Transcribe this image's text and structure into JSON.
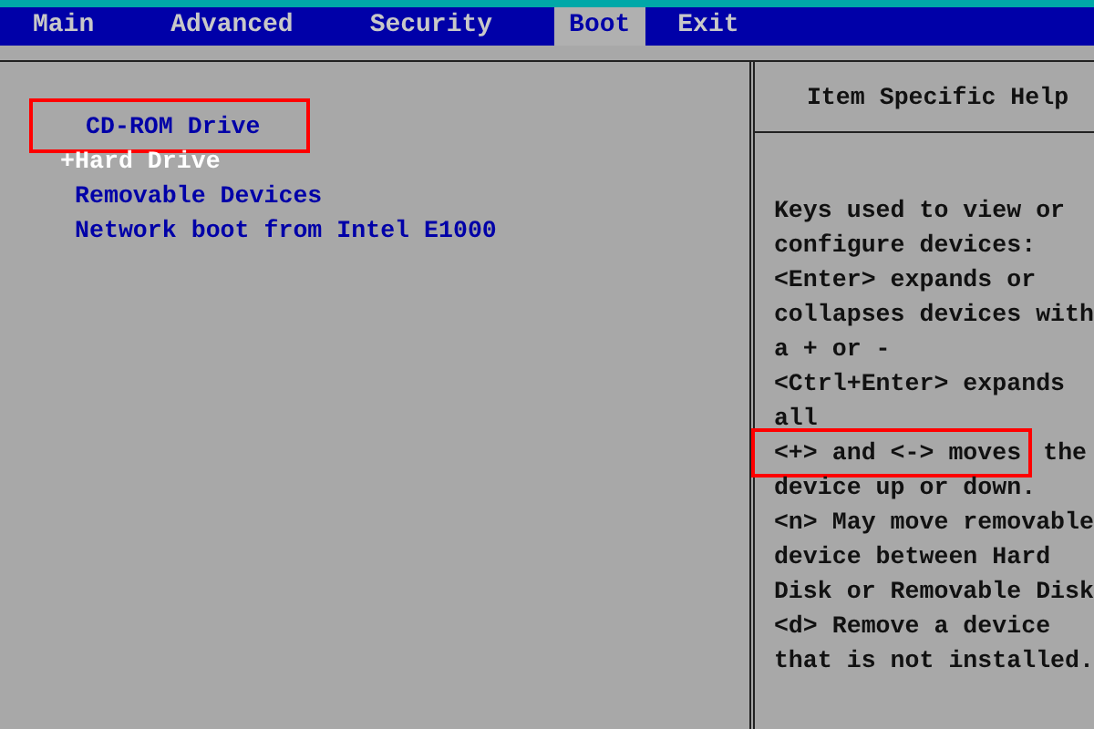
{
  "tabs": [
    {
      "label": "Main",
      "selected": false
    },
    {
      "label": "Advanced",
      "selected": false
    },
    {
      "label": "Security",
      "selected": false
    },
    {
      "label": "Boot",
      "selected": true
    },
    {
      "label": "Exit",
      "selected": false
    }
  ],
  "boot_items": [
    {
      "label": "CD-ROM Drive",
      "selected": false,
      "annotated": true
    },
    {
      "prefix": "+",
      "label": "Hard Drive",
      "selected": true,
      "annotated": false
    },
    {
      "label": "Removable Devices",
      "selected": false,
      "annotated": false
    },
    {
      "label": "Network boot from Intel E1000",
      "selected": false,
      "annotated": false
    }
  ],
  "help": {
    "title": "Item Specific Help",
    "lines": [
      {
        "text": "Keys used to view or",
        "annotated": false
      },
      {
        "text": "configure devices:",
        "annotated": false
      },
      {
        "text": "<Enter> expands or",
        "annotated": false
      },
      {
        "text": "collapses devices with",
        "annotated": false
      },
      {
        "text": "a + or -",
        "annotated": false
      },
      {
        "text": "<Ctrl+Enter> expands",
        "annotated": false
      },
      {
        "text": "all",
        "annotated": false
      },
      {
        "text": "<+> and <-> moves",
        "annotated": true,
        "after": "the"
      },
      {
        "text": "device up or down.",
        "annotated": false
      },
      {
        "text": "<n> May move removable",
        "annotated": false
      },
      {
        "text": "device between Hard",
        "annotated": false
      },
      {
        "text": "Disk or Removable Disk",
        "annotated": false
      },
      {
        "text": "<d> Remove a device",
        "annotated": false
      },
      {
        "text": "that is not installed.",
        "annotated": false
      }
    ]
  }
}
